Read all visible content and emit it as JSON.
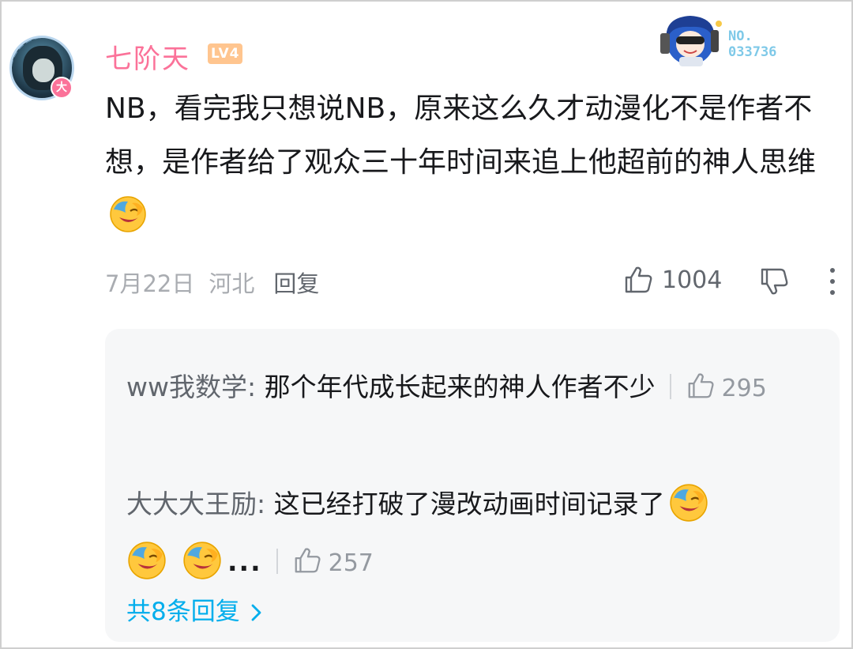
{
  "comment": {
    "username": "七阶天",
    "level": "LV4",
    "vip_badge": "大",
    "fan_number": "NO.\n033736",
    "text": "NB，看完我只想说NB，原来这么久才动漫化不是作者不想，是作者给了观众三十年时间来追上他超前的神人思维",
    "date": "7月22日",
    "location": "河北",
    "reply_label": "回复",
    "like_count": "1004"
  },
  "replies": [
    {
      "author": "ww我数学",
      "sep": ": ",
      "text": "那个年代成长起来的神人作者不少",
      "likes": "295"
    },
    {
      "author": "大大大王励",
      "sep": ": ",
      "text": "这已经打破了漫改动画时间记录了",
      "ellipsis": "...",
      "likes": "257"
    }
  ],
  "more_replies": "共8条回复",
  "colors": {
    "username": "#fb7299",
    "level_bg": "#ffc58f",
    "link": "#00aeec",
    "meta": "#a9acb1",
    "box": "#f6f7f8"
  },
  "icons": [
    "thumb-up-icon",
    "thumb-down-icon",
    "more-vertical-icon",
    "laugh-emoji-icon",
    "chevron-right-icon"
  ]
}
